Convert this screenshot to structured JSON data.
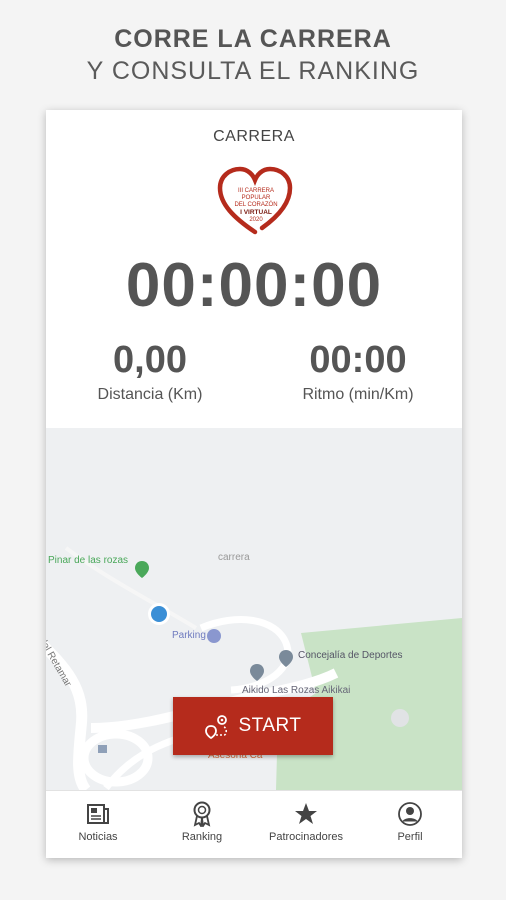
{
  "headline": {
    "line1": "CORRE LA CARRERA",
    "line2": "Y CONSULTA EL RANKING"
  },
  "race": {
    "title": "CARRERA",
    "logo_lines": [
      "III CARRERA",
      "POPULAR",
      "DEL CORAZÓN",
      "I VIRTUAL",
      "2020"
    ],
    "timer": "00:00:00",
    "distance": {
      "value": "0,00",
      "label": "Distancia (Km)"
    },
    "pace": {
      "value": "00:00",
      "label": "Ritmo (min/Km)"
    }
  },
  "map": {
    "labels": {
      "pinar": "Pinar de las rozas",
      "parking": "Parking",
      "concejalia": "Concejalía de Deportes",
      "aikido": "Aikido Las Rozas Aikikai",
      "street": "del Retamar",
      "extra": "Asesoria Ca",
      "carrera": "carrera"
    }
  },
  "start_button": {
    "label": "START"
  },
  "nav": {
    "items": [
      {
        "label": "Noticias",
        "icon": "newspaper-icon"
      },
      {
        "label": "Ranking",
        "icon": "award-icon"
      },
      {
        "label": "Patrocinadores",
        "icon": "star-icon"
      },
      {
        "label": "Perfil",
        "icon": "person-icon"
      }
    ]
  },
  "colors": {
    "accent": "#b52b1c",
    "text": "#555555",
    "map_green": "#c9e3c6",
    "location_blue": "#3b8fd6"
  }
}
